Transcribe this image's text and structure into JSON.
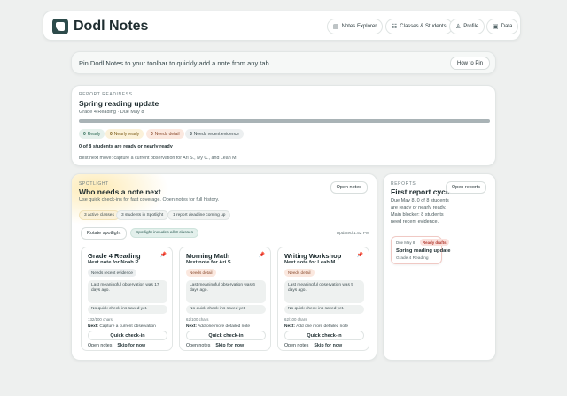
{
  "app": {
    "name": "Dodl Notes"
  },
  "nav": [
    {
      "label": "Notes Explorer",
      "icon": "notes-icon"
    },
    {
      "label": "Classes & Students",
      "icon": "classes-icon"
    },
    {
      "label": "Profile",
      "icon": "profile-icon"
    },
    {
      "label": "Data",
      "icon": "data-icon"
    }
  ],
  "pin_banner": {
    "text": "Pin Dodl Notes to your toolbar to quickly add a note from any tab.",
    "button": "How to Pin"
  },
  "readiness": {
    "kicker": "REPORT READINESS",
    "title": "Spring reading update",
    "subtitle": "Grade 4 Reading · Due May 8",
    "progress": 0,
    "pills": [
      {
        "count": "0",
        "label": "Ready"
      },
      {
        "count": "0",
        "label": "Nearly ready"
      },
      {
        "count": "0",
        "label": "Needs detail"
      },
      {
        "count": "8",
        "label": "Needs recent evidence"
      }
    ],
    "summary": "0 of 8 students are ready or nearly ready",
    "best_next": "Best next move: capture a current observation for Ari S., Ivy C., and Leah M."
  },
  "spotlight": {
    "kicker": "SPOTLIGHT",
    "title": "Who needs a note next",
    "subtitle": "Use quick check-ins for fast coverage. Open notes for full history.",
    "open_notes": "Open notes",
    "chips": [
      "3 active classes",
      "3 students in Spotlight",
      "1 report deadline coming up"
    ],
    "rotate": "Rotate spotlight",
    "includes": "Spotlight includes all 3 classes",
    "updated": "Updated 1:52 PM",
    "cards": [
      {
        "class": "Grade 4 Reading",
        "next_for": "Next note for Noah P.",
        "badge": "Needs recent evidence",
        "observation": "Last meaningful observation was 17 days ago.",
        "quick": "No quick check-ins saved yet.",
        "chars": "132/100 chars",
        "next_label": "Next:",
        "next_text": "Capture a current observation",
        "check_in": "Quick check-in",
        "open": "Open notes",
        "skip": "Skip for now"
      },
      {
        "class": "Morning Math",
        "next_for": "Next note for Ari S.",
        "badge": "Needs detail",
        "observation": "Last meaningful observation was 6 days ago.",
        "quick": "No quick check-ins saved yet.",
        "chars": "62/100 chars",
        "next_label": "Next:",
        "next_text": "Add one more detailed note",
        "check_in": "Quick check-in",
        "open": "Open notes",
        "skip": "Skip for now"
      },
      {
        "class": "Writing Workshop",
        "next_for": "Next note for Leah M.",
        "badge": "Needs detail",
        "observation": "Last meaningful observation was 5 days ago.",
        "quick": "No quick check-ins saved yet.",
        "chars": "62/100 chars",
        "next_label": "Next:",
        "next_text": "Add one more detailed note",
        "check_in": "Quick check-in",
        "open": "Open notes",
        "skip": "Skip for now"
      }
    ]
  },
  "reports": {
    "kicker": "REPORTS",
    "title": "First report cycle",
    "open": "Open reports",
    "text": "Due May 8. 0 of 8 students are ready or nearly ready. Main blocker: 8 students need recent evidence.",
    "item": {
      "date": "Due May 8",
      "badge": "Ready drafts",
      "title": "Spring reading update",
      "subtitle": "Grade 4 Reading"
    }
  },
  "colors": {
    "accent": "#2d4b4b",
    "ready": "#e6f1ec",
    "nearly": "#fbf1d9",
    "detail": "#fbe8df",
    "evidence": "#eceff0",
    "red": "#c2443b"
  }
}
